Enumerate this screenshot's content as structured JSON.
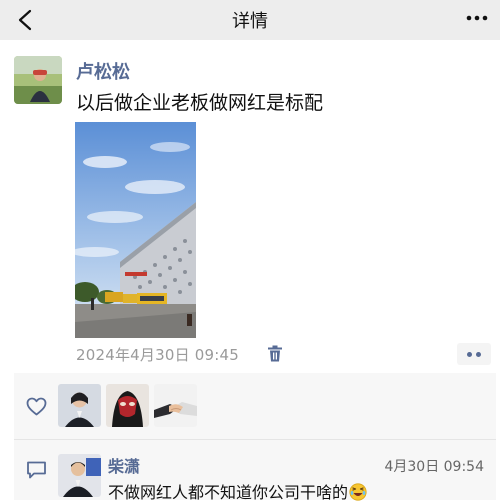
{
  "header": {
    "title": "详情",
    "back_icon": "chevron-left-icon",
    "more_icon": "more-dots-icon"
  },
  "post": {
    "author": "卢松松",
    "text": "以后做企业老板做网红是标配",
    "timestamp": "2024年4月30日 09:45",
    "delete_icon": "trash-icon",
    "action_icon": "ellipsis-icon"
  },
  "likes": {
    "icon": "heart-outline-icon",
    "avatars": [
      "liker-avatar-1",
      "liker-avatar-2",
      "liker-avatar-3"
    ]
  },
  "comment": {
    "icon": "comment-icon",
    "author": "柴潇",
    "time": "4月30日 09:54",
    "text": "不做网红人都不知道你公司干啥的",
    "emoji": "laughing-emoji"
  },
  "colors": {
    "header_bg": "#ededed",
    "name_link": "#576b95",
    "panel_bg": "#f7f7f7",
    "timestamp": "#9a9a9a"
  }
}
